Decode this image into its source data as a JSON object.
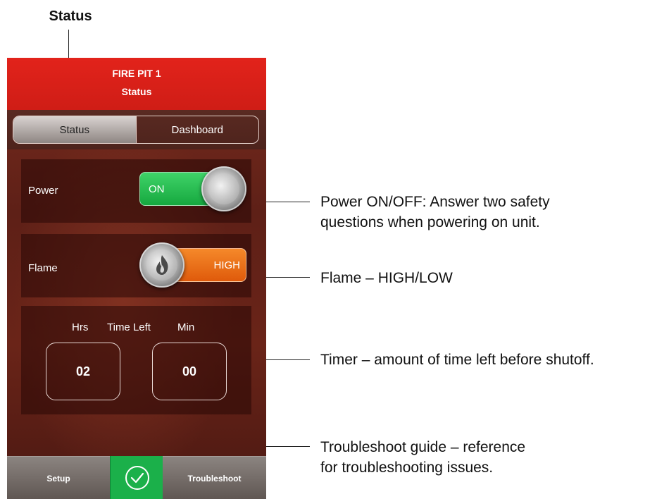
{
  "top_label": "Status",
  "app": {
    "header_title": "FIRE PIT 1",
    "header_subtitle": "Status",
    "tabs": [
      {
        "label": "Status",
        "active": true
      },
      {
        "label": "Dashboard",
        "active": false
      }
    ],
    "power": {
      "label": "Power",
      "value": "ON"
    },
    "flame": {
      "label": "Flame",
      "value": "HIGH"
    },
    "timer": {
      "hrs_label": "Hrs",
      "title": "Time Left",
      "min_label": "Min",
      "hrs_value": "02",
      "min_value": "00"
    },
    "footer": {
      "setup": "Setup",
      "troubleshoot": "Troubleshoot"
    }
  },
  "callouts": {
    "power_line1": "Power ON/OFF: Answer two safety",
    "power_line2": "questions when powering on unit.",
    "flame": "Flame – HIGH/LOW",
    "timer": "Timer – amount of time left before shutoff.",
    "trouble_line1": "Troubleshoot guide – reference",
    "trouble_line2": "for troubleshooting issues."
  },
  "colors": {
    "header_red": "#e2231b",
    "on_green": "#1db447",
    "high_orange": "#e8630f",
    "check_green": "#1bb04a"
  }
}
